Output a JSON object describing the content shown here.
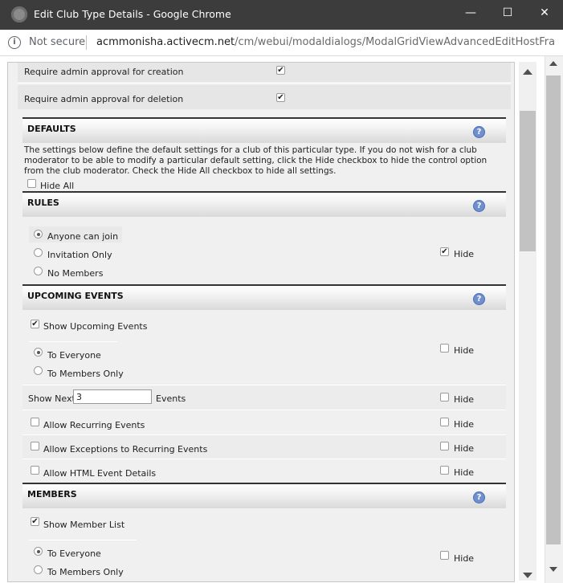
{
  "window": {
    "title": "Edit Club Type Details - Google Chrome",
    "minimize": "—",
    "maximize": "☐",
    "close": "✕"
  },
  "address": {
    "security": "Not secure",
    "host": "acmmonisha.activecm.net",
    "path": "/cm/webui/modaldialogs/ModalGridViewAdvancedEditHostFra..."
  },
  "approval": {
    "creation": "Require admin approval for creation",
    "deletion": "Require admin approval for deletion"
  },
  "defaults": {
    "title": "DEFAULTS",
    "description": "The settings below define the default settings for a club of this particular type. If you do not wish for a club moderator to be able to modify a particular default setting, click the Hide checkbox to hide the control option from the club moderator. Check the Hide All checkbox to hide all settings.",
    "hide_all": "Hide All"
  },
  "rules": {
    "title": "RULES",
    "options": [
      "Anyone can join",
      "Invitation Only",
      "No Members"
    ],
    "selected": "Anyone can join",
    "hide": "Hide"
  },
  "upcoming_events": {
    "title": "UPCOMING EVENTS",
    "show": "Show Upcoming Events",
    "audience": [
      "To Everyone",
      "To Members Only"
    ],
    "hide": "Hide",
    "show_next_label": "Show Next",
    "show_next_value": "3",
    "events_label": "Events",
    "recurring": "Allow Recurring Events",
    "exceptions": "Allow Exceptions to Recurring Events",
    "html_details": "Allow HTML Event Details"
  },
  "members": {
    "title": "MEMBERS",
    "show": "Show Member List",
    "audience": [
      "To Everyone",
      "To Members Only"
    ],
    "hide": "Hide"
  },
  "icons": {
    "check": "✔",
    "help": "?"
  }
}
